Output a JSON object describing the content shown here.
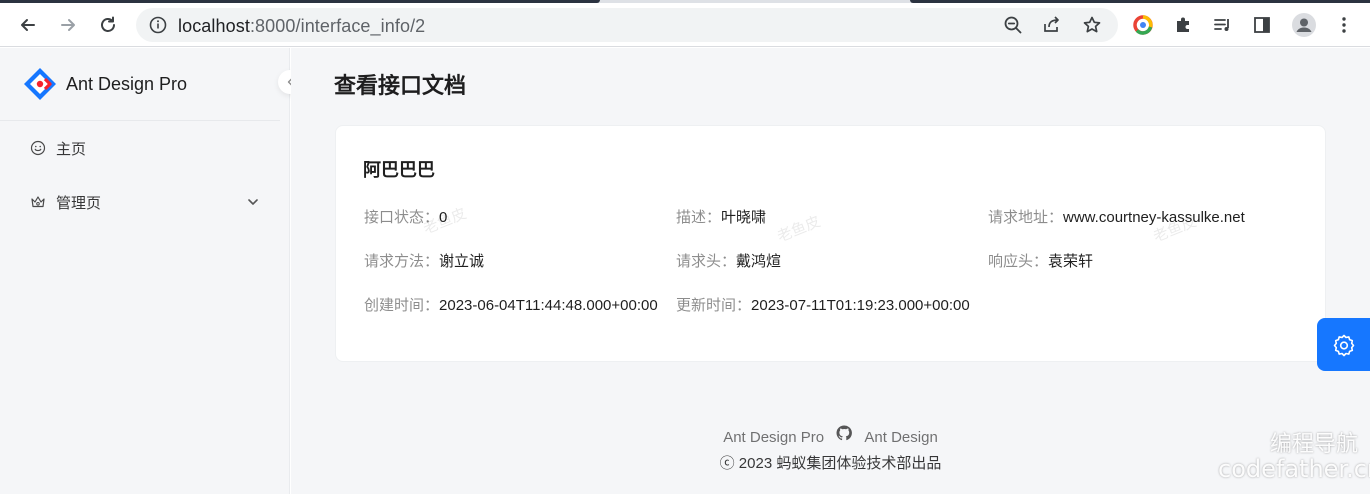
{
  "browser": {
    "url_host": "localhost",
    "url_rest": ":8000/interface_info/2"
  },
  "sidebar": {
    "app_title": "Ant Design Pro",
    "items": [
      {
        "label": "主页",
        "icon": "smile-icon"
      },
      {
        "label": "管理页",
        "icon": "crown-icon"
      }
    ]
  },
  "page": {
    "title": "查看接口文档"
  },
  "card": {
    "title": "阿巴巴巴",
    "fields": {
      "status_label": "接口状态：",
      "status_value": "0",
      "desc_label": "描述：",
      "desc_value": "叶晓啸",
      "url_label": "请求地址：",
      "url_value": "www.courtney-kassulke.net",
      "method_label": "请求方法：",
      "method_value": "谢立诚",
      "req_header_label": "请求头：",
      "req_header_value": "戴鸿煊",
      "resp_header_label": "响应头：",
      "resp_header_value": "袁荣轩",
      "created_label": "创建时间：",
      "created_value": "2023-06-04T11:44:48.000+00:00",
      "updated_label": "更新时间：",
      "updated_value": "2023-07-11T01:19:23.000+00:00"
    },
    "watermark": "老鱼皮"
  },
  "footer": {
    "link1": "Ant Design Pro",
    "link2": "Ant Design",
    "copyright": "ⓒ 2023 蚂蚁集团体验技术部出品"
  },
  "overlay": {
    "line1": "编程导航",
    "line2": "codefather.cn"
  },
  "colors": {
    "accent": "#1677ff",
    "sider_bg": "#f5f6f8"
  }
}
